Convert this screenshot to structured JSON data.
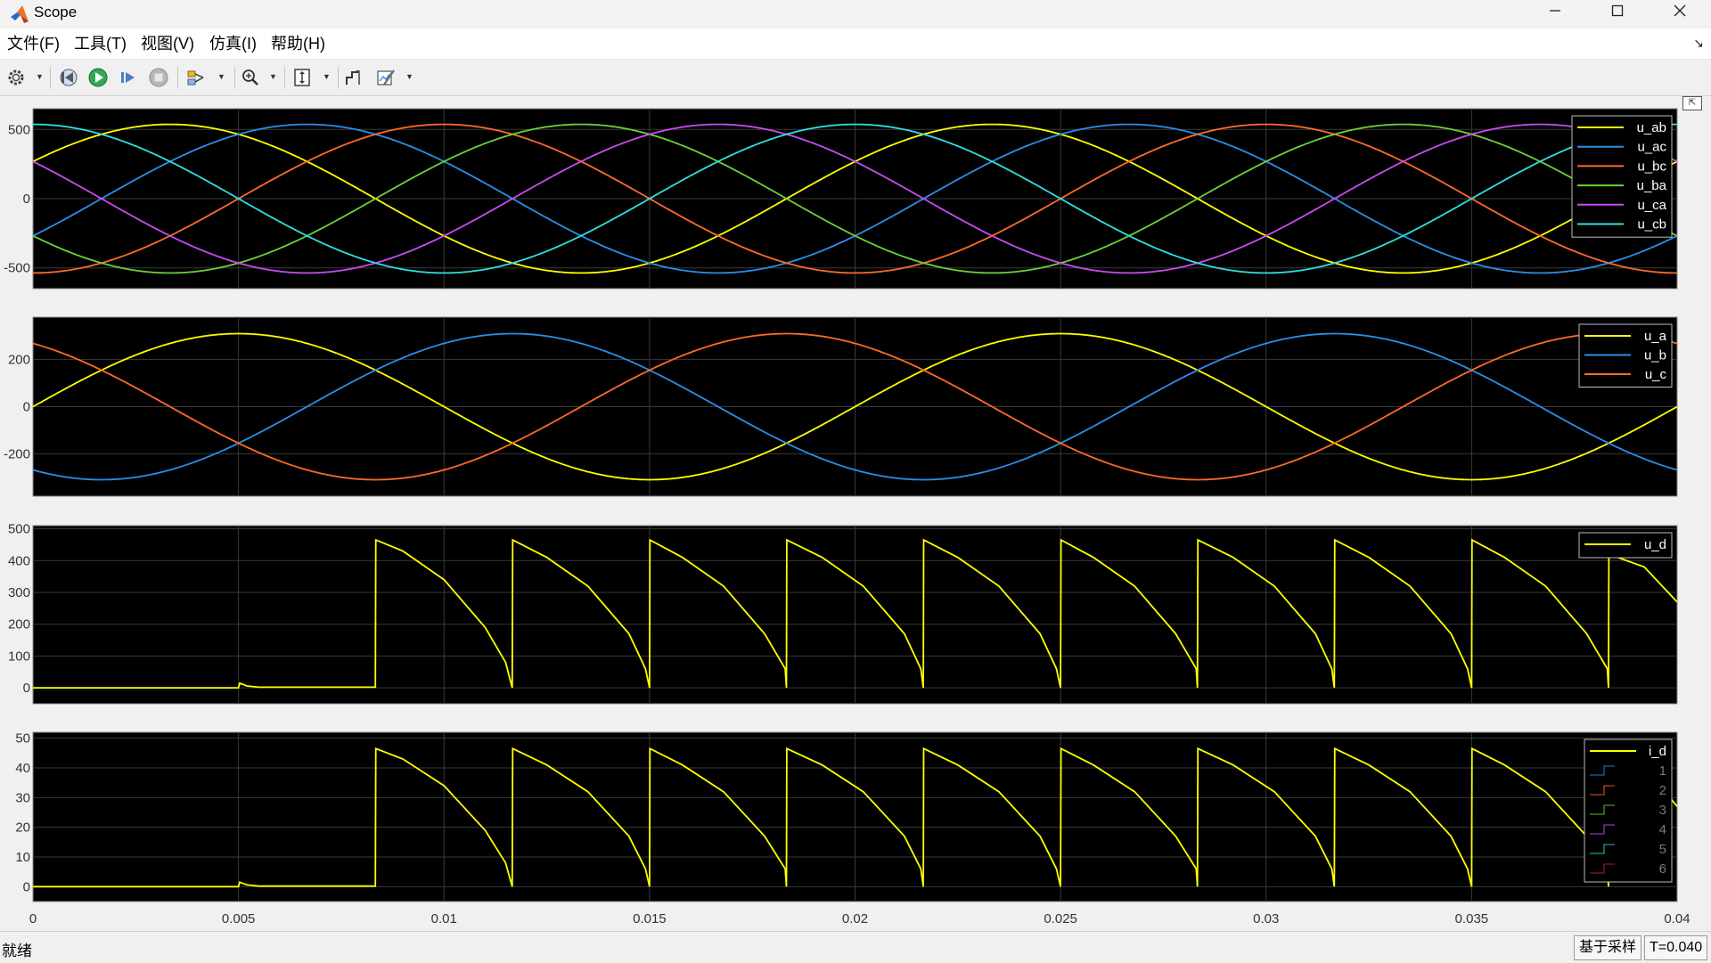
{
  "window": {
    "title": "Scope"
  },
  "menu": {
    "items": [
      "文件(F)",
      "工具(T)",
      "视图(V)",
      "仿真(I)",
      "帮助(H)"
    ]
  },
  "toolbar": {
    "icons": [
      "gear-icon",
      "step-back-icon",
      "run-icon",
      "step-forward-icon",
      "stop-icon",
      "signal-select-icon",
      "zoom-icon",
      "autoscale-icon",
      "cursor-measure-icon",
      "style-edit-icon"
    ]
  },
  "status": {
    "text": "就绪",
    "sample_mode": "基于采样",
    "time": "T=0.040"
  },
  "colors": {
    "yellow": "#ffff00",
    "blue": "#2a8fe8",
    "orange": "#ff6a2b",
    "green": "#6bd13b",
    "purple": "#c94cf0",
    "cyan": "#2ee0e0",
    "plot_bg": "#000000",
    "grid": "#3a3a3a"
  },
  "chart_data": [
    {
      "type": "line",
      "x_range": [
        0,
        0.04
      ],
      "ylim": [
        -650,
        650
      ],
      "yticks": [
        500,
        0,
        -500
      ],
      "ytick_labels": [
        "500",
        "0",
        "-500"
      ],
      "grid": true,
      "legend": "top-right",
      "formula": "sine",
      "series": [
        {
          "name": "u_ab",
          "color": "yellow",
          "amplitude": 537,
          "frequency": 50,
          "phase_deg": 30
        },
        {
          "name": "u_ac",
          "color": "blue",
          "amplitude": 537,
          "frequency": 50,
          "phase_deg": -30
        },
        {
          "name": "u_bc",
          "color": "orange",
          "amplitude": 537,
          "frequency": 50,
          "phase_deg": -90
        },
        {
          "name": "u_ba",
          "color": "green",
          "amplitude": 537,
          "frequency": 50,
          "phase_deg": -150
        },
        {
          "name": "u_ca",
          "color": "purple",
          "amplitude": 537,
          "frequency": 50,
          "phase_deg": 150
        },
        {
          "name": "u_cb",
          "color": "cyan",
          "amplitude": 537,
          "frequency": 50,
          "phase_deg": 90
        }
      ]
    },
    {
      "type": "line",
      "x_range": [
        0,
        0.04
      ],
      "ylim": [
        -380,
        380
      ],
      "yticks": [
        200,
        0,
        -200
      ],
      "ytick_labels": [
        "200",
        "0",
        "-200"
      ],
      "grid": true,
      "legend": "top-right",
      "formula": "sine",
      "series": [
        {
          "name": "u_a",
          "color": "yellow",
          "amplitude": 310,
          "frequency": 50,
          "phase_deg": 0
        },
        {
          "name": "u_b",
          "color": "blue",
          "amplitude": 310,
          "frequency": 50,
          "phase_deg": -120
        },
        {
          "name": "u_c",
          "color": "orange",
          "amplitude": 310,
          "frequency": 50,
          "phase_deg": 120
        }
      ]
    },
    {
      "type": "line",
      "x_range": [
        0,
        0.04
      ],
      "ylim": [
        -50,
        510
      ],
      "yticks": [
        500,
        400,
        300,
        200,
        100,
        0
      ],
      "ytick_labels": [
        "500",
        "400",
        "300",
        "200",
        "100",
        "0"
      ],
      "grid": true,
      "legend": "top-right",
      "series": [
        {
          "name": "u_d",
          "color": "yellow",
          "x": [
            0,
            0.005,
            0.00503,
            0.0052,
            0.0055,
            0.00833,
            0.00834,
            0.009,
            0.01,
            0.011,
            0.0115,
            0.01166,
            0.01167,
            0.0125,
            0.0135,
            0.0145,
            0.0149,
            0.015,
            0.01501,
            0.0158,
            0.0168,
            0.0178,
            0.0183,
            0.01833,
            0.01834,
            0.0192,
            0.0202,
            0.0212,
            0.0216,
            0.02166,
            0.02167,
            0.0225,
            0.0235,
            0.0245,
            0.0249,
            0.025,
            0.02501,
            0.0258,
            0.0268,
            0.0278,
            0.0283,
            0.02833,
            0.02834,
            0.0292,
            0.0302,
            0.0312,
            0.0316,
            0.03166,
            0.03167,
            0.0325,
            0.0335,
            0.0345,
            0.0349,
            0.035,
            0.03501,
            0.0358,
            0.0368,
            0.0378,
            0.0383,
            0.03833,
            0.03834,
            0.0392,
            0.04
          ],
          "y": [
            0,
            0,
            15,
            6,
            2,
            2,
            465,
            430,
            340,
            190,
            80,
            0,
            465,
            410,
            320,
            170,
            60,
            0,
            465,
            410,
            320,
            170,
            60,
            0,
            465,
            410,
            320,
            170,
            60,
            0,
            465,
            410,
            320,
            170,
            60,
            0,
            465,
            410,
            320,
            170,
            60,
            0,
            465,
            410,
            320,
            170,
            60,
            0,
            465,
            410,
            320,
            170,
            60,
            0,
            465,
            410,
            320,
            170,
            60,
            0,
            420,
            380,
            270
          ]
        }
      ]
    },
    {
      "type": "line",
      "x_range": [
        0,
        0.04
      ],
      "xticks": [
        0,
        0.005,
        0.01,
        0.015,
        0.02,
        0.025,
        0.03,
        0.035,
        0.04
      ],
      "xtick_labels": [
        "0",
        "0.005",
        "0.01",
        "0.015",
        "0.02",
        "0.025",
        "0.03",
        "0.035",
        "0.04"
      ],
      "ylim": [
        -5,
        52
      ],
      "yticks": [
        50,
        40,
        30,
        20,
        10,
        0
      ],
      "ytick_labels": [
        "50",
        "40",
        "30",
        "20",
        "10",
        "0"
      ],
      "grid": true,
      "legend": "top-right",
      "series": [
        {
          "name": "i_d",
          "color": "yellow",
          "x": [
            0,
            0.005,
            0.00503,
            0.0052,
            0.0055,
            0.00833,
            0.00834,
            0.009,
            0.01,
            0.011,
            0.0115,
            0.01166,
            0.01167,
            0.0125,
            0.0135,
            0.0145,
            0.0149,
            0.015,
            0.01501,
            0.0158,
            0.0168,
            0.0178,
            0.0183,
            0.01833,
            0.01834,
            0.0192,
            0.0202,
            0.0212,
            0.0216,
            0.02166,
            0.02167,
            0.0225,
            0.0235,
            0.0245,
            0.0249,
            0.025,
            0.02501,
            0.0258,
            0.0268,
            0.0278,
            0.0283,
            0.02833,
            0.02834,
            0.0292,
            0.0302,
            0.0312,
            0.0316,
            0.03166,
            0.03167,
            0.0325,
            0.0335,
            0.0345,
            0.0349,
            0.035,
            0.03501,
            0.0358,
            0.0368,
            0.0378,
            0.0383,
            0.03833,
            0.03834,
            0.0392,
            0.04
          ],
          "y": [
            0,
            0,
            1.5,
            0.6,
            0.2,
            0.2,
            46.5,
            43,
            34,
            19,
            8,
            0,
            46.5,
            41,
            32,
            17,
            6,
            0,
            46.5,
            41,
            32,
            17,
            6,
            0,
            46.5,
            41,
            32,
            17,
            6,
            0,
            46.5,
            41,
            32,
            17,
            6,
            0,
            46.5,
            41,
            32,
            17,
            6,
            0,
            46.5,
            41,
            32,
            17,
            6,
            0,
            46.5,
            41,
            32,
            17,
            6,
            0,
            46.5,
            41,
            32,
            17,
            6,
            0,
            46.5,
            41,
            27
          ]
        },
        {
          "name": "1",
          "color": "blue",
          "faded": true
        },
        {
          "name": "2",
          "color": "orange",
          "faded": true
        },
        {
          "name": "3",
          "color": "green",
          "faded": true
        },
        {
          "name": "4",
          "color": "purple",
          "faded": true
        },
        {
          "name": "5",
          "color": "cyan",
          "faded": true
        },
        {
          "name": "6",
          "color": "#d01a3a",
          "faded": true
        }
      ]
    }
  ]
}
